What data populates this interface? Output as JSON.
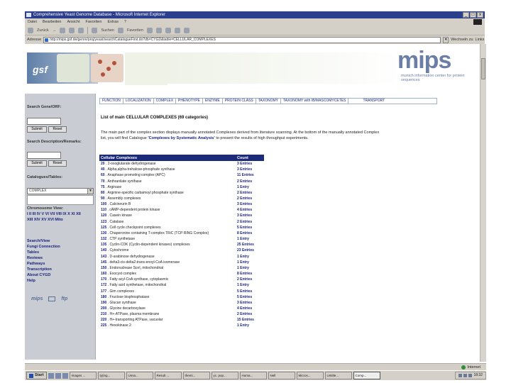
{
  "window": {
    "title": "Comprehensive Yeast Genome Database - Microsoft Internet Explorer",
    "buttons": [
      "_",
      "□",
      "x"
    ]
  },
  "menu": [
    "Datei",
    "Bearbeiten",
    "Ansicht",
    "Favoriten",
    "Extras",
    "?"
  ],
  "toolbar": {
    "back": "Zurück",
    "forward": "→",
    "search": "Suchen",
    "favorites": "Favoriten",
    "media": "Medien"
  },
  "address": {
    "label": "Adresse",
    "url": "http://mips.gsf.de/genre/proj/yeast/searchCatalogueFirst.do?db=CYGD&table=CELLULAR_COMPLEXES",
    "go": "Wechseln zu",
    "links": "Links"
  },
  "banner": {
    "gsf": "gsf",
    "mips": "mips",
    "mips_sub": "munich information center for protein sequences"
  },
  "sidebar": {
    "search_orf_label": "Search Gene/ORF:",
    "search_desc_label": "Search Description/Remarks:",
    "submit": "Submit",
    "reset": "Reset",
    "catalogues_label": "Catalogues/Tables:",
    "catalogue_selected": "COMPLEX",
    "chromosome_label": "Chromosome View:",
    "chromosomes": "I II III IV V VI VII VIII IX X XI XII XIII XIV XV XVI Mito",
    "links": [
      "Search/View",
      "Fungi Connection",
      "Tables",
      "Reviews",
      "Pathways",
      "Transcription",
      "About CYGD",
      "Help"
    ],
    "footer_mips": "mips",
    "footer_ftp": "ftp"
  },
  "tabs": [
    "FUNCTION",
    "LOCALIZATION",
    "COMPLEX",
    "PHENOTYPE",
    "ENZYME",
    "PROTEIN CLASS",
    "TAXONOMY",
    "TAXONOMY with IB/MASCOMYCETES",
    "TRANSPORT"
  ],
  "main": {
    "heading": "List of main CELLULAR COMPLEXES (69 categories)",
    "intro_a": "The main part of the complex section displays manually annotated Complexes derived from literature scanning. At the bottom of the manually annotated Complex list, you will find Catalogue",
    "intro_link": "'Complexes by Systematic Analysis'",
    "intro_b": "to present the results of high throughput experiments.",
    "col_complex": "Cellular Complexes",
    "col_count": "Count",
    "rows": [
      {
        "id": "20",
        "name": "2-oxoglutarate dehydrogenase",
        "count": "3 Entries"
      },
      {
        "id": "40",
        "name": "Alpha,alpha-trehalose-phosphate synthase",
        "count": "3 Entries"
      },
      {
        "id": "60",
        "name": "Anaphase promoting complex (APC)",
        "count": "11 Entries"
      },
      {
        "id": "70",
        "name": "Anthranilate synthase",
        "count": "2 Entries"
      },
      {
        "id": "75",
        "name": "Arginase",
        "count": "1 Entry"
      },
      {
        "id": "80",
        "name": "Arginine-specific carbamoyl phosphate synthase",
        "count": "2 Entries"
      },
      {
        "id": "90",
        "name": "Assembly complexes",
        "count": "2 Entries"
      },
      {
        "id": "100",
        "name": "Calcineurin B",
        "count": "3 Entries"
      },
      {
        "id": "110",
        "name": "cAMP-dependent protein kinase",
        "count": "4 Entries"
      },
      {
        "id": "120",
        "name": "Casein kinase",
        "count": "3 Entries"
      },
      {
        "id": "123",
        "name": "Catalase",
        "count": "2 Entries"
      },
      {
        "id": "125",
        "name": "Cell cycle checkpoint complexes",
        "count": "5 Entries"
      },
      {
        "id": "130",
        "name": "Chaperonine containing T-complex TRiC (TCP RING Complex)",
        "count": "8 Entries"
      },
      {
        "id": "132",
        "name": "CTP synthetase",
        "count": "1 Entry"
      },
      {
        "id": "135",
        "name": "Cyclin-CDK (Cyclin-dependent kinases) complexes",
        "count": "25 Entries"
      },
      {
        "id": "140",
        "count": "23 Entries",
        "name": "Cytochrome"
      },
      {
        "id": "143",
        "name": "D-arabinose dehydrogenase",
        "count": "1 Entry"
      },
      {
        "id": "145",
        "name": "delta3-cis-delta2-trans-enoyl-CoA isomerase",
        "count": "1 Entry"
      },
      {
        "id": "150",
        "name": "Endonuclease SceI, mitochondrial",
        "count": "1 Entry"
      },
      {
        "id": "160",
        "name": "Exocyst complex",
        "count": "8 Entries"
      },
      {
        "id": "170",
        "name": "Fatty acyl-CoA synthase, cytoplasmic",
        "count": "2 Entries"
      },
      {
        "id": "172",
        "name": "Fatty acid synthetase, mitochondrial",
        "count": "1 Entry"
      },
      {
        "id": "177",
        "name": "Gim complexes",
        "count": "5 Entries"
      },
      {
        "id": "180",
        "name": "Fructose bisphosphatase",
        "count": "5 Entries"
      },
      {
        "id": "190",
        "name": "Glucan synthase",
        "count": "3 Entries"
      },
      {
        "id": "200",
        "name": "Glycine decarboxylase",
        "count": "4 Entries"
      },
      {
        "id": "210",
        "name": "H+-ATPase, plasma membrane",
        "count": "2 Entries"
      },
      {
        "id": "220",
        "name": "H+-transporting ATPase, vacuolar",
        "count": "15 Entries"
      },
      {
        "id": "225",
        "name": "Hexokinase 2",
        "count": "1 Entry"
      }
    ]
  },
  "status": {
    "text": "",
    "zone": "Internet"
  },
  "taskbar": {
    "start": "Start",
    "tasks": [
      "Images ...",
      "ty(ing...",
      "Unsa...",
      "Result ...",
      "themi...",
      "yc. pop...",
      "Huma...",
      "Nell",
      "Micros...",
      "Untitle...",
      "Comp..."
    ],
    "clock": "18:32"
  }
}
